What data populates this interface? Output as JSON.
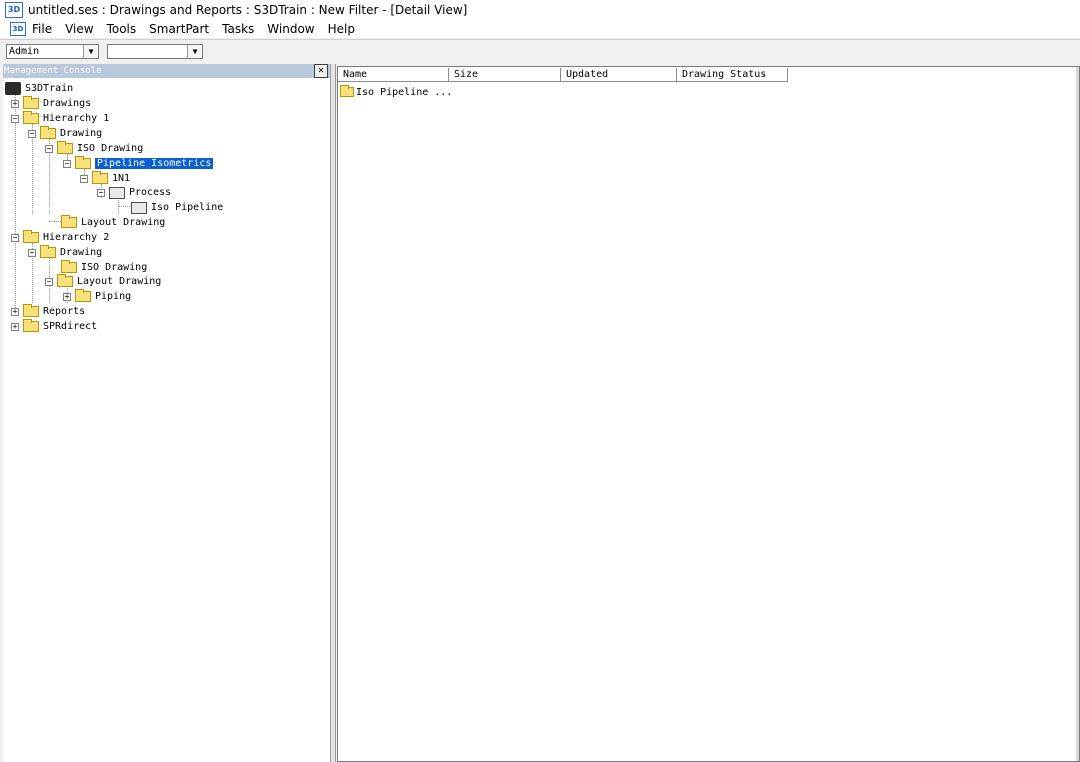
{
  "window": {
    "app_icon": "3D",
    "title": "untitled.ses : Drawings and Reports : S3DTrain : New Filter - [Detail View]"
  },
  "menubar": {
    "doc_icon": "3D",
    "items": [
      "File",
      "View",
      "Tools",
      "SmartPart",
      "Tasks",
      "Window",
      "Help"
    ]
  },
  "toolbar": {
    "role_value": "Admin",
    "second_value": ""
  },
  "management_console": {
    "title": "Management Console",
    "close_label": "✕",
    "tree": {
      "root": "S3DTrain",
      "drawings": "Drawings",
      "hierarchy1": "Hierarchy 1",
      "h1_drawing": "Drawing",
      "h1_iso_drawing": "ISO Drawing",
      "pipeline_isometrics": "Pipeline Isometrics",
      "node_1n1": "1N1",
      "process": "Process",
      "iso_pipeline": "Iso Pipeline",
      "h1_layout_drawing": "Layout Drawing",
      "hierarchy2": "Hierarchy 2",
      "h2_drawing": "Drawing",
      "h2_iso_drawing": "ISO Drawing",
      "h2_layout_drawing": "Layout Drawing",
      "piping": "Piping",
      "reports": "Reports",
      "sprdirect": "SPRdirect"
    }
  },
  "detail_view": {
    "columns": [
      "Name",
      "Size",
      "Updated",
      "Drawing Status"
    ],
    "rows": [
      {
        "name": "Iso Pipeline ..."
      }
    ]
  },
  "colors": {
    "selection": "#0a5fd1",
    "panel_title": "#b9c9db",
    "folder": "#f8e07a"
  }
}
